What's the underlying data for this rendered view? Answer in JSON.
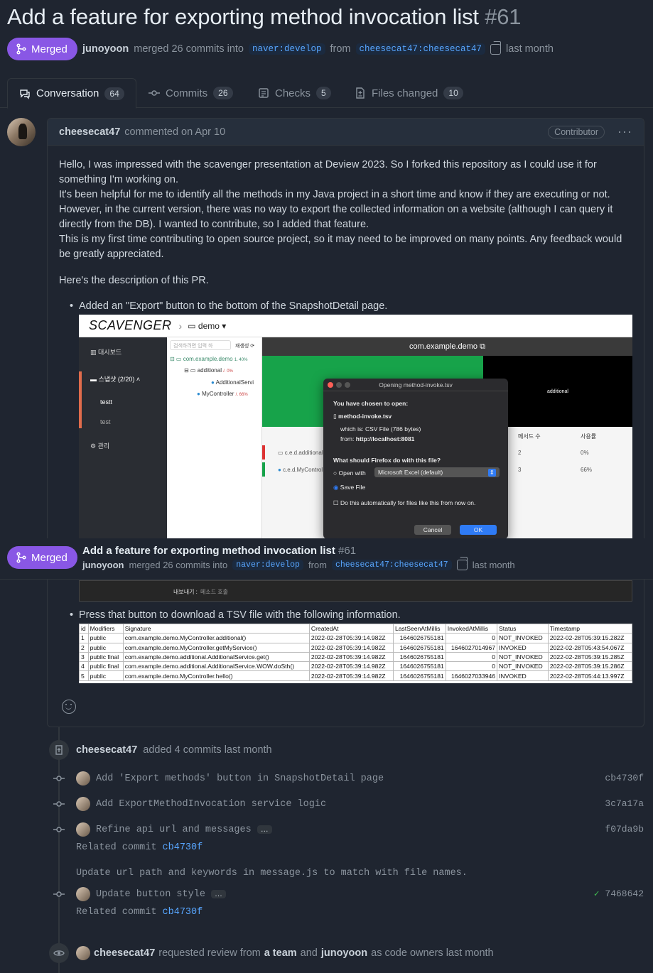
{
  "header": {
    "title": "Add a feature for exporting method invocation list",
    "number": "#61",
    "state": "Merged",
    "author": "junoyoon",
    "action": "merged 26 commits into",
    "base_branch": "naver:develop",
    "from_word": "from",
    "head_branch": "cheesecat47:cheesecat47",
    "time": "last month"
  },
  "tabs": [
    {
      "label": "Conversation",
      "count": "64"
    },
    {
      "label": "Commits",
      "count": "26"
    },
    {
      "label": "Checks",
      "count": "5"
    },
    {
      "label": "Files changed",
      "count": "10"
    }
  ],
  "comment": {
    "author": "cheesecat47",
    "action": "commented on Apr 10",
    "role": "Contributor",
    "para1": "Hello, I was impressed with the scavenger presentation at Deview 2023. So I forked this repository as I could use it for something I'm working on.",
    "para2": "It's been helpful for me to identify all the methods in my Java project in a short time and know if they are executing or not. However, in the current version, there was no way to export the collected information on a website (although I can query it directly from the DB). I wanted to contribute, so I added that feature.",
    "para3": "This is my first time contributing to open source project, so it may need to be improved on many points. Any feedback would be greatly appreciated.",
    "para4": "Here's the description of this PR.",
    "bullet1": "Added an \"Export\" button to the bottom of the SnapshotDetail page.",
    "bullet2": "Press that button to download a TSV file with the following information."
  },
  "screenshot": {
    "logo": "SCAVENGER",
    "project": "demo",
    "side_dashboard": "대시보드",
    "side_snapshot": "스냅샷 (2/20)",
    "side_testt": "testt",
    "side_test": "test",
    "side_admin": "관리",
    "search_placeholder": "검색하려면 입력 하",
    "regen": "재생성",
    "tree_root": "com.example.demo",
    "tree_root_pct": "1. 40%",
    "tree_additional": "additional",
    "tree_additional_pct": "/. 0%",
    "tree_additional_service": "AdditionalServi",
    "tree_controller": "MyController",
    "tree_controller_pct": "/. 66%",
    "main_title": "com.example.demo",
    "main_block": "additional",
    "col_methods": "메서드 수",
    "col_usage": "사용률",
    "row1_name": "c.e.d.additional",
    "row1_count": "2",
    "row1_pct": "0%",
    "row2_name": "c.e.d.MyControl",
    "row2_count": "3",
    "row2_pct": "66%",
    "export_label": "내보내기 :",
    "export_value": "메소드 호출",
    "dialog": {
      "title": "Opening method-invoke.tsv",
      "chosen": "You have chosen to open:",
      "file": "method-invoke.tsv",
      "which": "which is: CSV File (786 bytes)",
      "from_label": "from:",
      "from_url": "http://localhost:8081",
      "question": "What should Firefox do with this file?",
      "open_with": "Open with",
      "app": "Microsoft Excel (default)",
      "save": "Save File",
      "auto": "Do this automatically for files like this from now on.",
      "cancel": "Cancel",
      "ok": "OK"
    }
  },
  "tsv": {
    "headers": [
      "id",
      "Modifiers",
      "Signature",
      "CreatedAt",
      "LastSeenAtMillis",
      "InvokedAtMillis",
      "Status",
      "Timestamp"
    ],
    "rows": [
      [
        "1",
        "public",
        "com.example.demo.MyController.additional()",
        "2022-02-28T05:39:14.982Z",
        "1646026755181",
        "0",
        "NOT_INVOKED",
        "2022-02-28T05:39:15.282Z"
      ],
      [
        "2",
        "public",
        "com.example.demo.MyController.getMyService()",
        "2022-02-28T05:39:14.982Z",
        "1646026755181",
        "1646027014967",
        "INVOKED",
        "2022-02-28T05:43:54.067Z"
      ],
      [
        "3",
        "public final",
        "com.example.demo.additional.AdditionalService.get()",
        "2022-02-28T05:39:14.982Z",
        "1646026755181",
        "0",
        "NOT_INVOKED",
        "2022-02-28T05:39:15.285Z"
      ],
      [
        "4",
        "public final",
        "com.example.demo.additional.AdditionalService.WOW.doSth()",
        "2022-02-28T05:39:14.982Z",
        "1646026755181",
        "0",
        "NOT_INVOKED",
        "2022-02-28T05:39:15.286Z"
      ],
      [
        "5",
        "public",
        "com.example.demo.MyController.hello()",
        "2022-02-28T05:39:14.982Z",
        "1646026755181",
        "1646027033946",
        "INVOKED",
        "2022-02-28T05:44:13.997Z"
      ]
    ]
  },
  "timeline": {
    "added_author": "cheesecat47",
    "added_text": "added 4 commits last month",
    "commits": [
      {
        "message": "Add 'Export methods' button in SnapshotDetail page",
        "sha": "cb4730f"
      },
      {
        "message": "Add ExportMethodInvocation service logic",
        "sha": "3c7a17a"
      },
      {
        "message": "Refine api url and messages",
        "sha": "f07da9b",
        "more": "…"
      },
      {
        "message": "Update button style",
        "sha": "7468642",
        "more": "…"
      }
    ],
    "related_label": "Related commit",
    "related_sha": "cb4730f",
    "related_label2": "Related commit",
    "related_sha2": "cb4730f",
    "refine_detail": "Update url path and keywords in message.js to match with file names.",
    "review_author": "cheesecat47",
    "review_text1": "requested review from",
    "review_team": "a team",
    "review_and": "and",
    "review_owner": "junoyoon",
    "review_text2": "as code owners last month"
  }
}
